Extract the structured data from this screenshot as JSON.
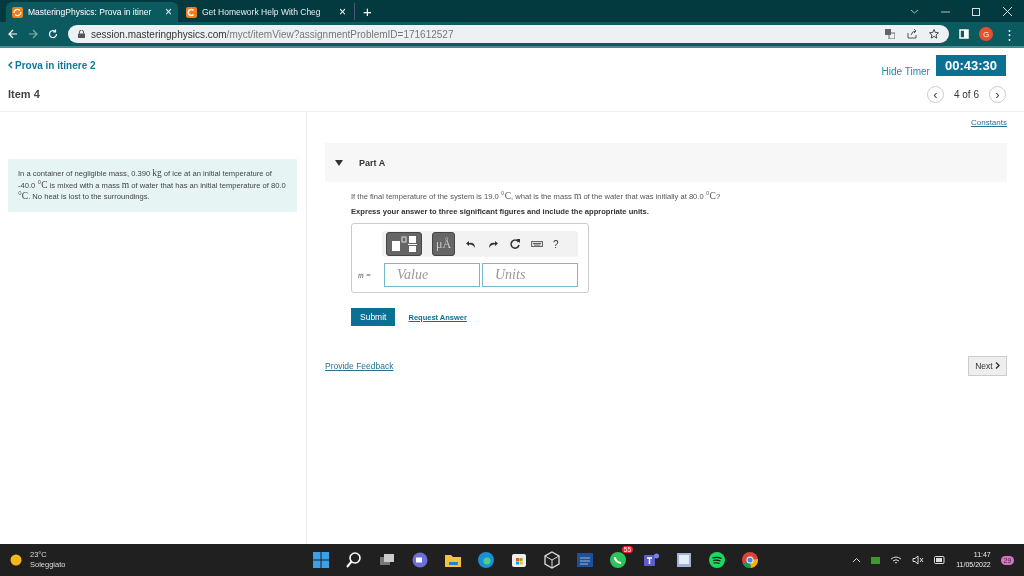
{
  "browser": {
    "tabs": [
      {
        "title": "MasteringPhysics: Prova in itiner",
        "selected": true,
        "close": "×"
      },
      {
        "title": "Get Homework Help With Cheg",
        "selected": false,
        "close": "×"
      }
    ],
    "new_tab": "+",
    "url_host": "session.masteringphysics.com",
    "url_path": "/myct/itemView?assignmentProblemID=171612527",
    "avatar": "G",
    "menu": "⋮"
  },
  "page": {
    "back_link": "Prova in itinere 2",
    "hide_timer": "Hide Timer",
    "timer": "00:43:30",
    "item_title": "Item 4",
    "pager": {
      "prev": "‹",
      "label": "4 of 6",
      "next": "›"
    },
    "constants": "Constants",
    "problem": [
      {
        "kind": "text",
        "t": "In a container of negligible mass, 0.390 "
      },
      {
        "kind": "math",
        "t": "kg"
      },
      {
        "kind": "text",
        "t": " of ice at an initial temperature of -40.0 "
      },
      {
        "kind": "math",
        "t": "°C"
      },
      {
        "kind": "text",
        "t": " is mixed with a mass "
      },
      {
        "kind": "math",
        "t": "m"
      },
      {
        "kind": "text",
        "t": " of water that has an initial temperature of 80.0 "
      },
      {
        "kind": "math",
        "t": "°C"
      },
      {
        "kind": "text",
        "t": ". No heat is lost to the surroundings."
      }
    ],
    "part": {
      "title": "Part A",
      "expanded": true,
      "question": [
        {
          "kind": "text",
          "t": "If the final temperature of the system is 19.0 "
        },
        {
          "kind": "math",
          "t": "°C"
        },
        {
          "kind": "text",
          "t": ", what is the mass "
        },
        {
          "kind": "math",
          "t": "m"
        },
        {
          "kind": "text",
          "t": " of the water that was initially at 80.0 "
        },
        {
          "kind": "math",
          "t": "°C"
        },
        {
          "kind": "text",
          "t": "?"
        }
      ],
      "instruction": "Express your answer to three significant figures and include the appropriate units.",
      "toolbar": {
        "units_button": "μÅ",
        "help": "?"
      },
      "variable": "m =",
      "value_placeholder": "Value",
      "units_placeholder": "Units",
      "submit": "Submit",
      "request_answer": "Request Answer"
    },
    "feedback": "Provide Feedback",
    "next": "Next"
  },
  "taskbar": {
    "temperature": "23°C",
    "weather": "Soleggiato",
    "whatsapp_badge": "55",
    "time": "11:47",
    "date": "11/05/2022",
    "notifications": "29"
  }
}
